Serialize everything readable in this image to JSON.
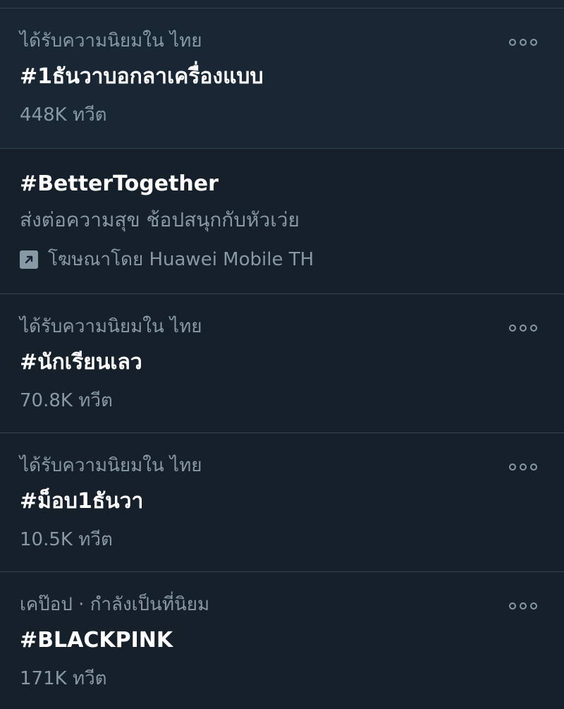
{
  "trends": [
    {
      "context": "ได้รับความนิยมใน ไทย",
      "title": "#1ธันวาบอกลาเครื่องแบบ",
      "count": "448K ทวีต"
    },
    {
      "title": "#BetterTogether",
      "description": "ส่งต่อความสุข ช้อปสนุกกับหัวเว่ย",
      "promoted": "โฆษณาโดย Huawei Mobile TH",
      "promoted_icon": "promoted-arrow-icon"
    },
    {
      "context": "ได้รับความนิยมใน ไทย",
      "title": "#นักเรียนเลว",
      "count": "70.8K ทวีต"
    },
    {
      "context": "ได้รับความนิยมใน ไทย",
      "title": "#ม็อบ1ธันวา",
      "count": "10.5K ทวีต"
    },
    {
      "context": "เคป๊อป · กำลังเป็นที่นิยม",
      "title": "#BLACKPINK",
      "count": "171K ทวีต"
    }
  ],
  "more_icon": "more-options-icon",
  "colors": {
    "background": "#15202b",
    "highlight": "#192734",
    "divider": "#38444d",
    "secondary_text": "#8899a6",
    "primary_text": "#ffffff"
  }
}
